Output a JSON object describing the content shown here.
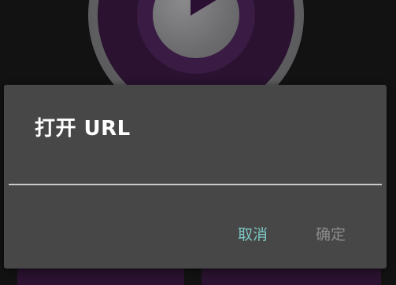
{
  "dialog": {
    "title": "打开 URL",
    "url_value": "",
    "cancel_label": "取消",
    "ok_label": "确定",
    "ok_enabled": false
  },
  "background": {
    "center_icon": "play-icon"
  },
  "colors": {
    "dialog_bg": "#474747",
    "cancel_accent": "#7cc6c3",
    "ok_disabled": "#8c8c8c",
    "player_purple": "#2a1230"
  }
}
